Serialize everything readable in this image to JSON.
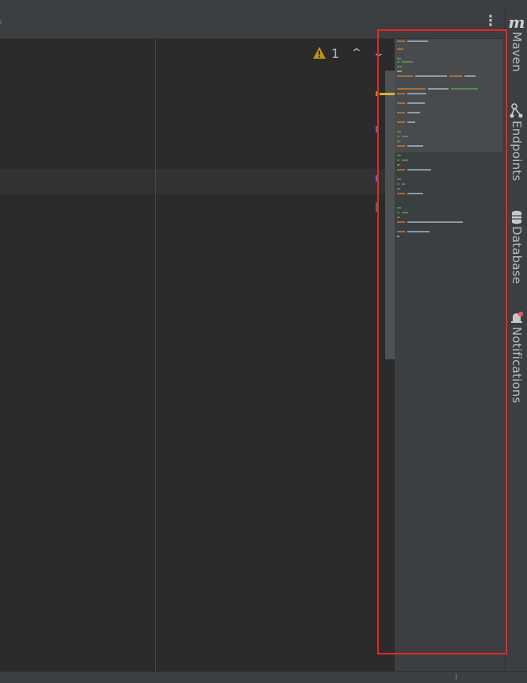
{
  "tab_bar": {
    "more_glyph": "⋮",
    "chevron_glyph": "‹"
  },
  "inspection_widget": {
    "warning_count": "1",
    "prev_glyph": "⌃",
    "next_glyph": "⌄",
    "icon": "warning-triangle-icon",
    "color": "#be9117"
  },
  "right_toolbar": {
    "items": [
      {
        "label": "Maven",
        "icon": "maven-icon",
        "glyph": "m"
      },
      {
        "label": "Endpoints",
        "icon": "endpoints-icon"
      },
      {
        "label": "Database",
        "icon": "database-icon"
      },
      {
        "label": "Notifications",
        "icon": "notifications-bell-icon"
      }
    ]
  },
  "bottom_bar": {
    "glyph": "⁝"
  },
  "colors": {
    "editor_bg": "#2b2b2b",
    "panel_bg": "#3c3f41",
    "highlight_border": "#e8262a",
    "minimap_keyword": "#cc7832",
    "minimap_comment": "#629755",
    "minimap_text": "#a9b7c6"
  }
}
